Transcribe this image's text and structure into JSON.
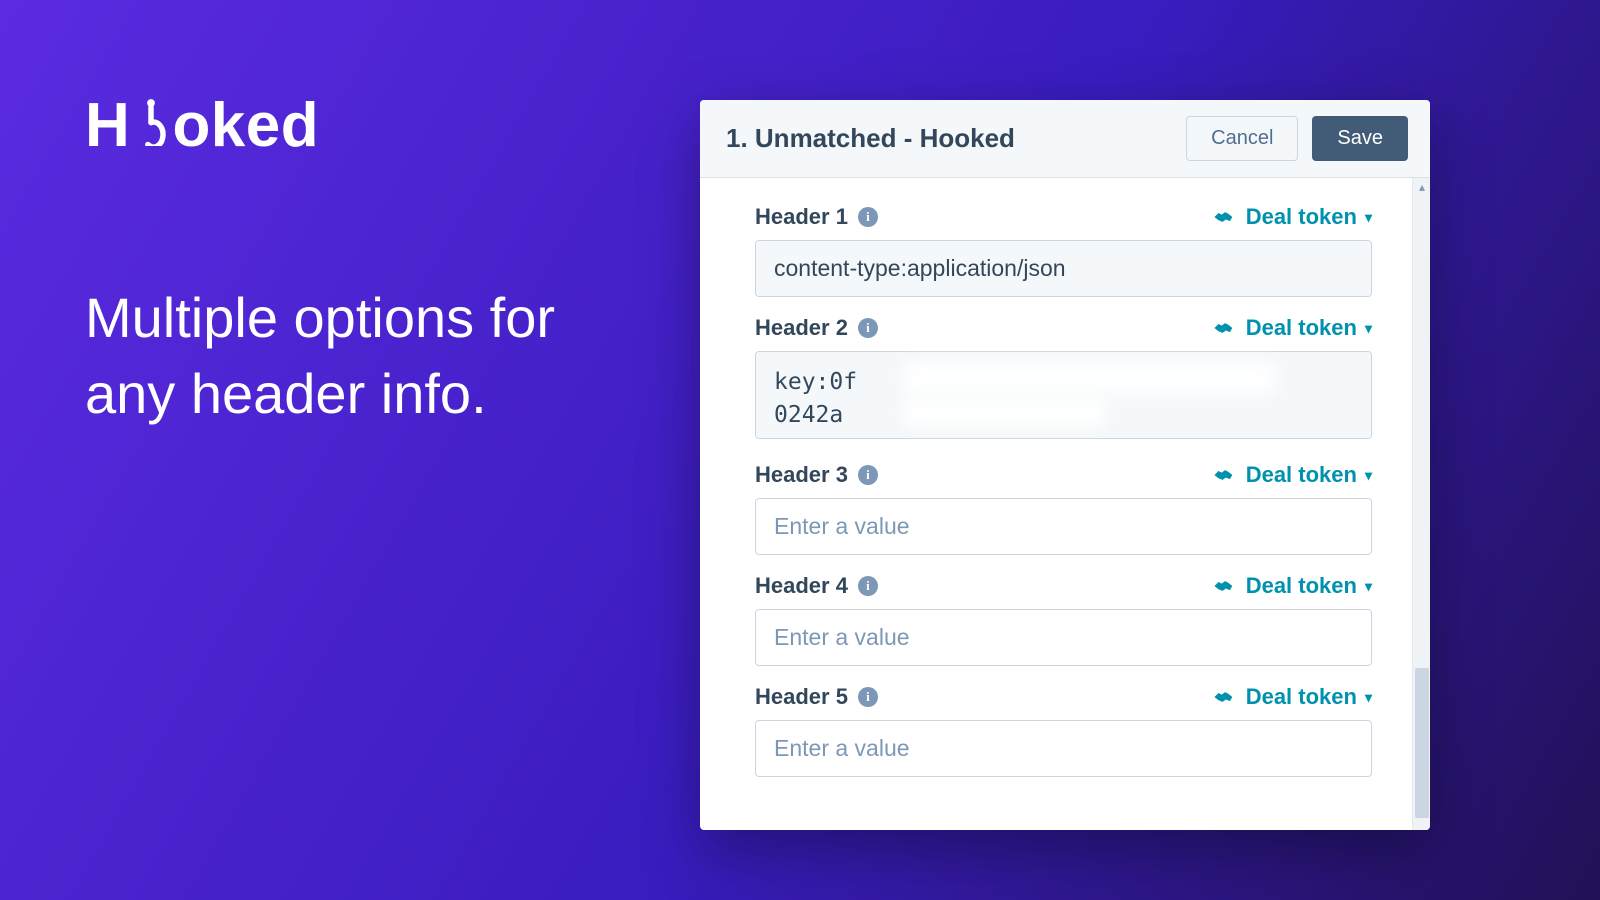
{
  "brand": {
    "name": "Hooked"
  },
  "headline": "Multiple options for any header info.",
  "panel": {
    "title": "1. Unmatched - Hooked",
    "cancel_label": "Cancel",
    "save_label": "Save",
    "deal_token_label": "Deal token",
    "input_placeholder": "Enter a value",
    "headers": [
      {
        "label": "Header 1",
        "value": "content-type:application/json",
        "placeholder": ""
      },
      {
        "label": "Header 2",
        "value": "key:0f\n0242a",
        "placeholder": "",
        "multiline": true,
        "redacted": true
      },
      {
        "label": "Header 3",
        "value": "",
        "placeholder": "Enter a value"
      },
      {
        "label": "Header 4",
        "value": "",
        "placeholder": "Enter a value"
      },
      {
        "label": "Header 5",
        "value": "",
        "placeholder": "Enter a value"
      }
    ]
  },
  "colors": {
    "bg_gradient_start": "#5b2be0",
    "bg_gradient_end": "#221156",
    "accent": "#0091ae",
    "text_dark": "#33475b",
    "button_primary": "#425b76"
  }
}
